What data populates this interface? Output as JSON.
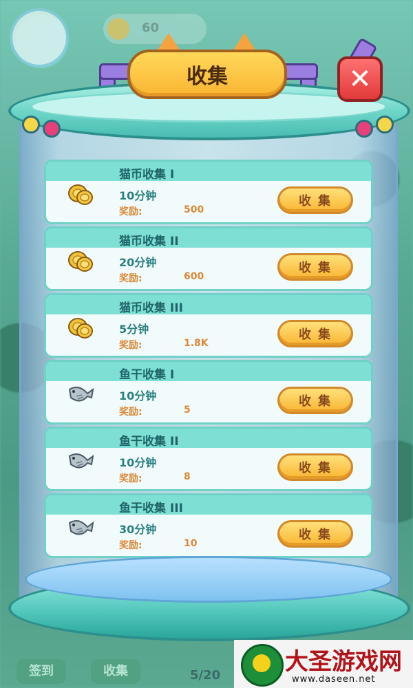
{
  "background": {
    "coin_balance": "60",
    "bottom_tabs": [
      "签到",
      "收集"
    ],
    "stage_counter": "5/20"
  },
  "dialog": {
    "title": "收集",
    "close_symbol": "✕"
  },
  "tasks": [
    {
      "title": "猫币收集 I",
      "duration": "10分钟",
      "reward_label": "奖励:",
      "reward_value": "500",
      "icon": "coin-stack-icon",
      "button_label": "收集"
    },
    {
      "title": "猫币收集 II",
      "duration": "20分钟",
      "reward_label": "奖励:",
      "reward_value": "600",
      "icon": "coin-stack-icon",
      "button_label": "收集"
    },
    {
      "title": "猫币收集 III",
      "duration": "5分钟",
      "reward_label": "奖励:",
      "reward_value": "1.8K",
      "icon": "coin-stack-icon",
      "button_label": "收集"
    },
    {
      "title": "鱼干收集 I",
      "duration": "10分钟",
      "reward_label": "奖励:",
      "reward_value": "5",
      "icon": "dried-fish-icon",
      "button_label": "收集"
    },
    {
      "title": "鱼干收集 II",
      "duration": "10分钟",
      "reward_label": "奖励:",
      "reward_value": "8",
      "icon": "dried-fish-icon",
      "button_label": "收集"
    },
    {
      "title": "鱼干收集 III",
      "duration": "30分钟",
      "reward_label": "奖励:",
      "reward_value": "10",
      "icon": "dried-fish-icon",
      "button_label": "收集"
    }
  ],
  "watermark": {
    "name": "大圣游戏网",
    "url": "www.daseen.net"
  },
  "colors": {
    "tube_teal": "#6fd6c9",
    "button_gold": "#f9b531",
    "close_red": "#e23a3a",
    "reward_orange": "#d98a3a",
    "title_teal": "#1f6368"
  }
}
